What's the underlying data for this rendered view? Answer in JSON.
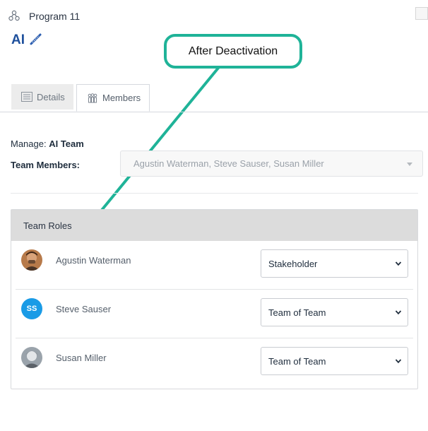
{
  "header": {
    "program_label": "Program 11",
    "team_title": "AI"
  },
  "callout": {
    "text": "After Deactivation",
    "color": "#1fb398"
  },
  "tabs": [
    {
      "label": "Details",
      "icon": "document-icon",
      "active": false
    },
    {
      "label": "Members",
      "icon": "people-icon",
      "active": true
    }
  ],
  "manage": {
    "label": "Manage:",
    "team": "AI Team"
  },
  "team_members": {
    "label": "Team Members:",
    "value": "Agustin Waterman, Steve Sauser, Susan Miller"
  },
  "roles": {
    "header": "Team Roles",
    "members": [
      {
        "name": "Agustin Waterman",
        "role": "Stakeholder",
        "avatar": "photo"
      },
      {
        "name": "Steve Sauser",
        "role": "Team of Team",
        "avatar": "SS"
      },
      {
        "name": "Susan Miller",
        "role": "Team of Team",
        "avatar": "photo"
      }
    ]
  },
  "colors": {
    "accent_blue": "#1d4f9c",
    "avatar_blue": "#1a9be6",
    "callout_teal": "#1fb398"
  }
}
